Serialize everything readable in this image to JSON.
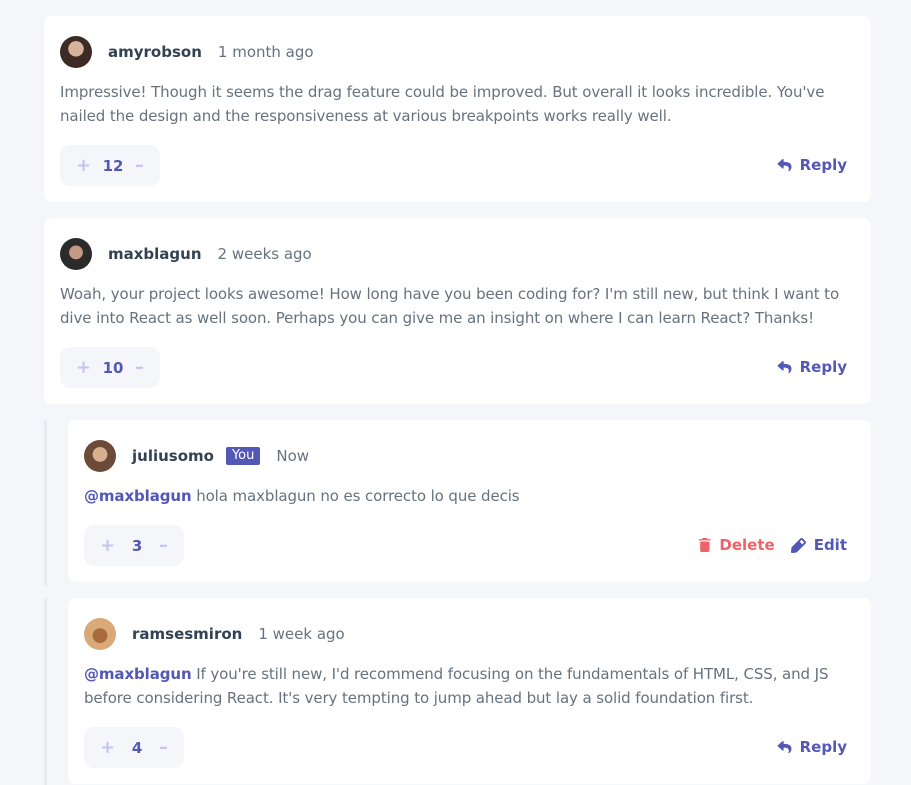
{
  "comments": [
    {
      "user": "amyrobson",
      "time": "1 month ago",
      "text": "Impressive! Though it seems the drag feature could be improved. But overall it looks incredible. You've nailed the design and the responsiveness at various breakpoints works really well.",
      "score": "12",
      "reply_label": "Reply"
    },
    {
      "user": "maxblagun",
      "time": "2 weeks ago",
      "text": "Woah, your project looks awesome! How long have you been coding for? I'm still new, but think I want to dive into React as well soon. Perhaps you can give me an insight on where I can learn React? Thanks!",
      "score": "10",
      "reply_label": "Reply"
    }
  ],
  "replies": [
    {
      "user": "juliusomo",
      "badge": "You",
      "time": "Now",
      "mention": "@maxblagun",
      "text": " hola maxblagun no es correcto lo que decis",
      "score": "3",
      "delete_label": "Delete",
      "edit_label": "Edit"
    },
    {
      "user": "ramsesmiron",
      "time": "1 week ago",
      "mention": "@maxblagun",
      "text": " If you're still new, I'd recommend focusing on the fundamentals of HTML, CSS, and JS before considering React. It's very tempting to jump ahead but lay a solid foundation first.",
      "score": "4",
      "reply_label": "Reply"
    }
  ],
  "vote": {
    "plus": "+",
    "minus": "–"
  },
  "colors": {
    "accent": "#5357b6",
    "danger": "#ed6368",
    "background": "#f5f6fa"
  },
  "icons": [
    "plus-icon",
    "minus-icon",
    "reply-icon",
    "delete-icon",
    "edit-icon"
  ]
}
